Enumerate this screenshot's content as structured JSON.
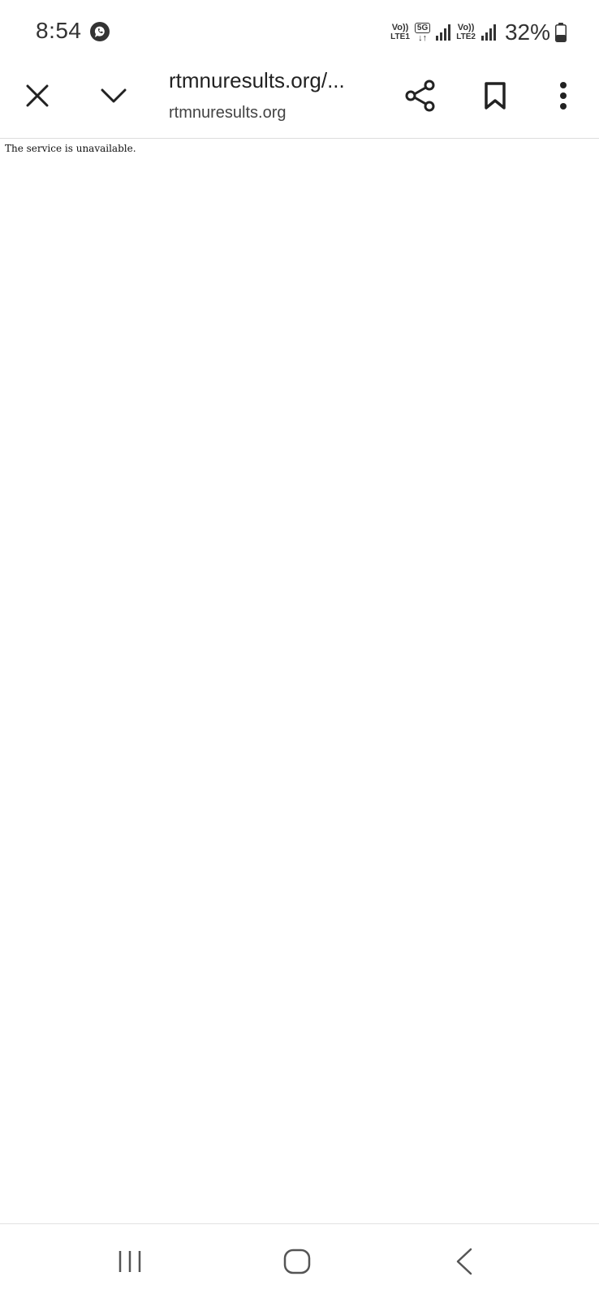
{
  "status_bar": {
    "time": "8:54",
    "sim1_top": "Vo))",
    "sim1_bottom": "LTE1",
    "net_badge": "5G",
    "net_arrows": "↓↑",
    "sim2_top": "Vo))",
    "sim2_bottom": "LTE2",
    "battery": "32%"
  },
  "toolbar": {
    "url_title": "rtmnuresults.org/...",
    "url_domain": "rtmnuresults.org"
  },
  "page": {
    "message": "The service is unavailable."
  },
  "icons": {
    "close": "close-icon",
    "chevron": "chevron-down-icon",
    "share": "share-icon",
    "bookmark": "bookmark-icon",
    "menu": "more-vert-icon",
    "recents": "recents-icon",
    "home": "home-icon",
    "back": "back-icon"
  },
  "colors": {
    "icon": "#222222",
    "divider": "#dddddd",
    "nav_icon": "#555555"
  }
}
